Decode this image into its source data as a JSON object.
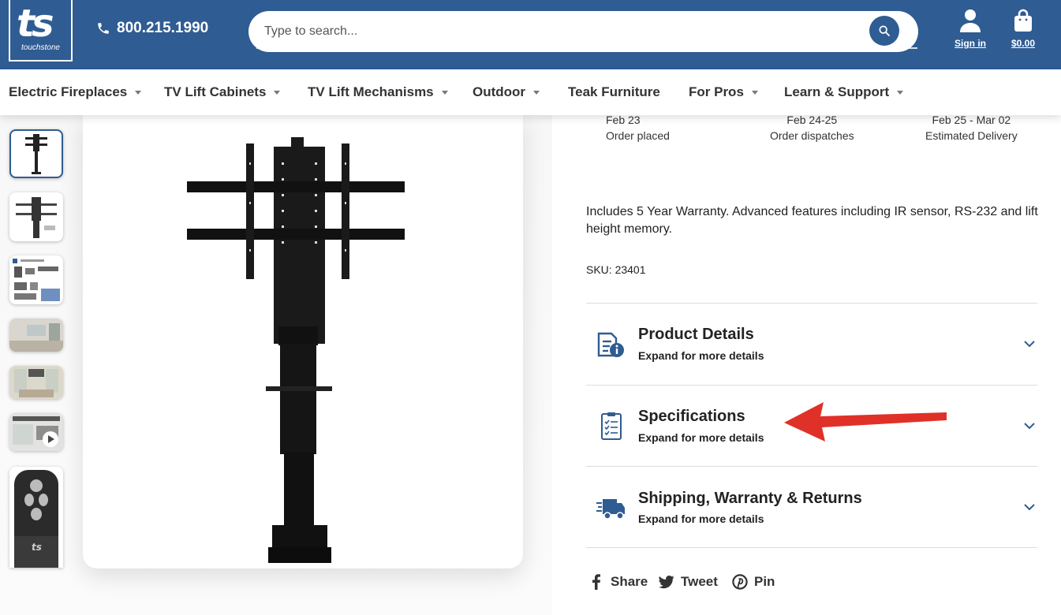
{
  "header": {
    "logo_text": "ts",
    "logo_sub": "touchstone",
    "phone": "800.215.1990",
    "search_placeholder": "Type to search...",
    "sign_in": "Sign in",
    "cart_total": "$0.00"
  },
  "nav": [
    {
      "label": "Electric Fireplaces",
      "has_menu": true
    },
    {
      "label": "TV Lift Cabinets",
      "has_menu": true
    },
    {
      "label": "TV Lift Mechanisms",
      "has_menu": true
    },
    {
      "label": "Outdoor",
      "has_menu": true
    },
    {
      "label": "Teak Furniture",
      "has_menu": false
    },
    {
      "label": "For Pros",
      "has_menu": true
    },
    {
      "label": "Learn & Support",
      "has_menu": true
    }
  ],
  "timeline": [
    {
      "date": "Feb 23",
      "label": "Order placed"
    },
    {
      "date": "Feb 24-25",
      "label": "Order dispatches"
    },
    {
      "date": "Feb 25 - Mar 02",
      "label": "Estimated Delivery"
    }
  ],
  "product": {
    "description": "Includes 5 Year Warranty. Advanced features including IR sensor, RS-232 and lift height memory.",
    "sku": "SKU: 23401"
  },
  "accordions": [
    {
      "title": "Product Details",
      "subtitle": "Expand for more details",
      "icon": "document-info-icon"
    },
    {
      "title": "Specifications",
      "subtitle": "Expand for more details",
      "icon": "clipboard-checklist-icon"
    },
    {
      "title": "Shipping, Warranty & Returns",
      "subtitle": "Expand for more details",
      "icon": "delivery-truck-icon"
    }
  ],
  "share": [
    {
      "label": "Share",
      "icon": "facebook-icon"
    },
    {
      "label": "Tweet",
      "icon": "twitter-icon"
    },
    {
      "label": "Pin",
      "icon": "pinterest-icon"
    }
  ],
  "colors": {
    "brand_blue": "#2f5c92",
    "annotation_red": "#e03128"
  }
}
